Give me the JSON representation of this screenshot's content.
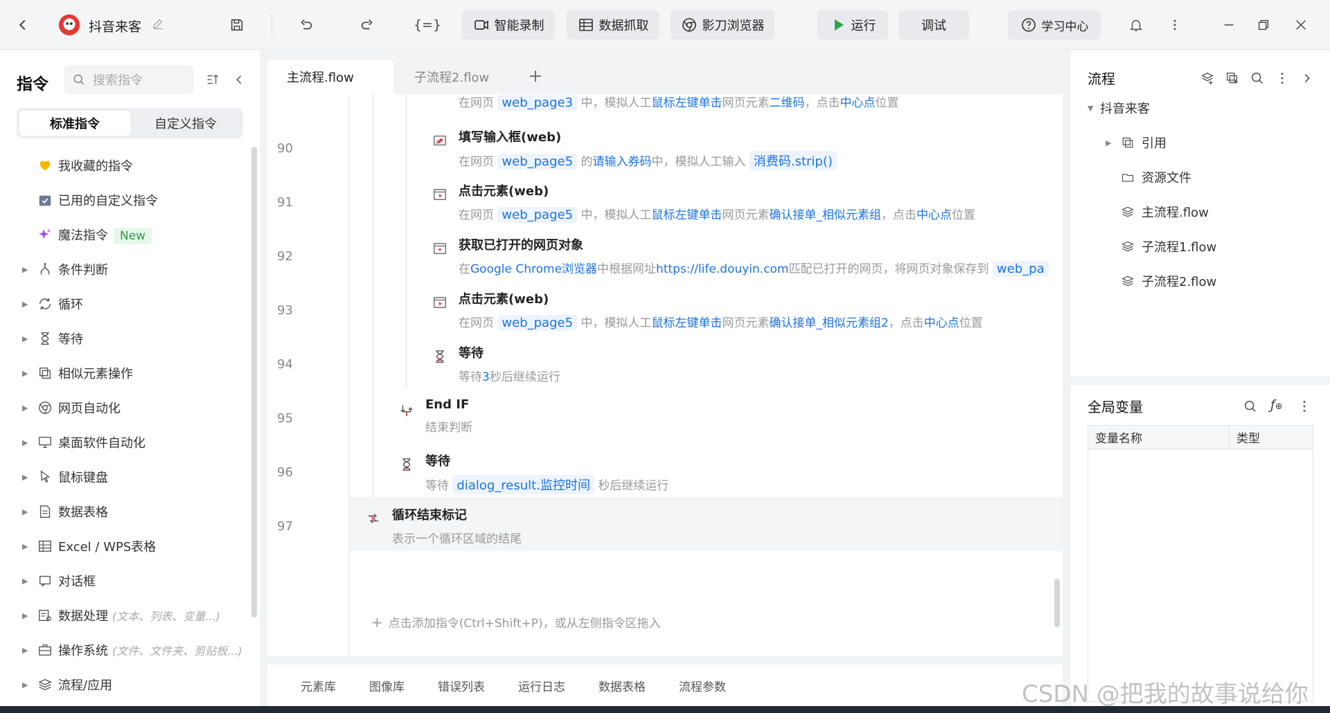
{
  "app": {
    "project_name": "抖音来客",
    "toolbar": {
      "smart_record": "智能录制",
      "data_scrape": "数据抓取",
      "browser": "影刀浏览器",
      "run": "运行",
      "debug": "调试",
      "learn": "学习中心"
    }
  },
  "sidebar": {
    "title": "指令",
    "search_placeholder": "搜索指令",
    "segments": [
      "标准指令",
      "自定义指令"
    ],
    "items": [
      {
        "label": "我收藏的指令",
        "icon": "heart-icon",
        "expandable": false
      },
      {
        "label": "已用的自定义指令",
        "icon": "calendar-check-icon",
        "expandable": false
      },
      {
        "label": "魔法指令",
        "icon": "sparkle-icon",
        "expandable": false,
        "badge": "New"
      },
      {
        "label": "条件判断",
        "icon": "branch-icon",
        "expandable": true
      },
      {
        "label": "循环",
        "icon": "loop-icon",
        "expandable": true
      },
      {
        "label": "等待",
        "icon": "hourglass-icon",
        "expandable": true
      },
      {
        "label": "相似元素操作",
        "icon": "copy-icon",
        "expandable": true
      },
      {
        "label": "网页自动化",
        "icon": "chrome-icon",
        "expandable": true
      },
      {
        "label": "桌面软件自动化",
        "icon": "monitor-icon",
        "expandable": true
      },
      {
        "label": "鼠标键盘",
        "icon": "cursor-icon",
        "expandable": true
      },
      {
        "label": "数据表格",
        "icon": "document-icon",
        "expandable": true
      },
      {
        "label": "Excel / WPS表格",
        "icon": "excel-icon",
        "expandable": true
      },
      {
        "label": "对话框",
        "icon": "dialog-icon",
        "expandable": true
      },
      {
        "label": "数据处理",
        "icon": "data-icon",
        "expandable": true,
        "hint": "(文本、列表、变量...)"
      },
      {
        "label": "操作系统",
        "icon": "briefcase-icon",
        "expandable": true,
        "hint": "(文件、文件夹、剪贴板...)"
      },
      {
        "label": "流程/应用",
        "icon": "layers-icon",
        "expandable": true
      }
    ]
  },
  "editor": {
    "tabs": [
      "主流程.flow",
      "子流程2.flow"
    ],
    "partial_top": {
      "prefix": "在网页",
      "var": "web_page3",
      "mid": "中，模拟人工",
      "action": "鼠标左键单击",
      "mid2": "网页元素",
      "target": "二维码",
      "mid3": "，点击",
      "point": "中心点",
      "suffix": "位置"
    },
    "steps": [
      {
        "line": "90",
        "title": "填写输入框(web)",
        "d1": "在网页",
        "v1": "web_page5",
        "d2": "的",
        "h1": "请输入券码",
        "d3": "中，模拟人工输入",
        "v2": "消费码.strip()"
      },
      {
        "line": "91",
        "title": "点击元素(web)",
        "d1": "在网页",
        "v1": "web_page5",
        "d2": "中，模拟人工",
        "h1": "鼠标左键单击",
        "d3": "网页元素",
        "h2": "确认接单_相似元素组",
        "d4": "，点击",
        "h3": "中心点",
        "d5": "位置"
      },
      {
        "line": "92",
        "title": "获取已打开的网页对象",
        "d1": "在",
        "h1": "Google Chrome浏览器",
        "d2": "中根据网址",
        "h2": "https://life.douyin.com",
        "d3": "匹配已打开的网页，将网页对象保存到",
        "v1": "web_pa"
      },
      {
        "line": "93",
        "title": "点击元素(web)",
        "d1": "在网页",
        "v1": "web_page5",
        "d2": "中，模拟人工",
        "h1": "鼠标左键单击",
        "d3": "网页元素",
        "h2": "确认接单_相似元素组2",
        "d4": "，点击",
        "h3": "中心点",
        "d5": "位置"
      },
      {
        "line": "94",
        "title": "等待",
        "d1": "等待",
        "h1": "3",
        "d2": "秒后继续运行"
      },
      {
        "line": "95",
        "title": "End IF",
        "d1": "结束判断"
      },
      {
        "line": "96",
        "title": "等待",
        "d1": "等待",
        "v1": "dialog_result.监控时间",
        "d2": "秒后继续运行"
      },
      {
        "line": "97",
        "title": "循环结束标记",
        "d1": "表示一个循环区域的结尾"
      }
    ],
    "add_hint": "点击添加指令(Ctrl+Shift+P)，或从左侧指令区拖入",
    "bottom_tabs": [
      "元素库",
      "图像库",
      "错误列表",
      "运行日志",
      "数据表格",
      "流程参数"
    ]
  },
  "right_panel": {
    "flow_title": "流程",
    "tree": {
      "root": "抖音来客",
      "items": [
        "引用",
        "资源文件",
        "主流程.flow",
        "子流程1.flow",
        "子流程2.flow"
      ]
    },
    "vars_title": "全局变量",
    "columns": [
      "变量名称",
      "类型"
    ]
  },
  "watermark": "CSDN @把我的故事说给你"
}
